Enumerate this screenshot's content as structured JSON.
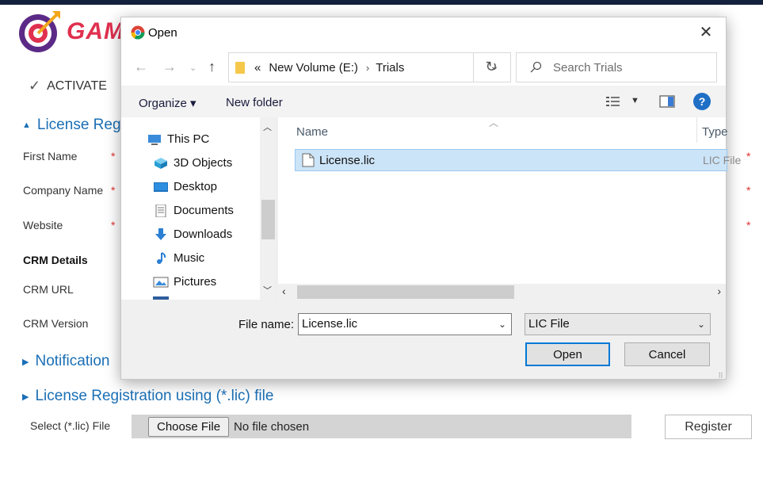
{
  "page": {
    "logo_text": "GAM",
    "activate_label": "ACTIVATE",
    "sections": {
      "license_registration": "License Regis",
      "notification": "Notification",
      "license_file": "License Registration using (*.lic) file"
    },
    "fields": {
      "first_name": "First Name",
      "company_name": "Company Name",
      "website": "Website",
      "crm_details": "CRM Details",
      "crm_url": "CRM URL",
      "crm_version": "CRM Version"
    },
    "required_mark": "*",
    "file_select_label": "Select (*.lic) File",
    "choose_file_label": "Choose File",
    "no_file_text": "No file chosen",
    "register_label": "Register"
  },
  "dialog": {
    "title": "Open",
    "close_glyph": "✕",
    "address": {
      "overflow": "«",
      "path": [
        "New Volume (E:)",
        "Trials"
      ],
      "separator": "›"
    },
    "search_placeholder": "Search Trials",
    "toolbar": {
      "organize_label": "Organize ▾",
      "new_folder_label": "New folder",
      "help_glyph": "?"
    },
    "nav_items": [
      {
        "label": "This PC",
        "icon": "computer-icon"
      },
      {
        "label": "3D Objects",
        "icon": "cube-icon"
      },
      {
        "label": "Desktop",
        "icon": "desktop-icon"
      },
      {
        "label": "Documents",
        "icon": "document-icon"
      },
      {
        "label": "Downloads",
        "icon": "download-icon"
      },
      {
        "label": "Music",
        "icon": "music-icon"
      },
      {
        "label": "Pictures",
        "icon": "pictures-icon"
      }
    ],
    "columns": {
      "name": "Name",
      "type": "Type"
    },
    "files": [
      {
        "name": "License.lic",
        "type": "LIC File",
        "selected": true
      }
    ],
    "file_name_label": "File name:",
    "file_name_value": "License.lic",
    "file_type_value": "LIC File",
    "open_label": "Open",
    "cancel_label": "Cancel"
  },
  "colors": {
    "accent": "#0078d7",
    "section_blue": "#1b6fb5",
    "required_red": "#e03030",
    "selection": "#cce4f7",
    "topbar": "#14213d"
  }
}
